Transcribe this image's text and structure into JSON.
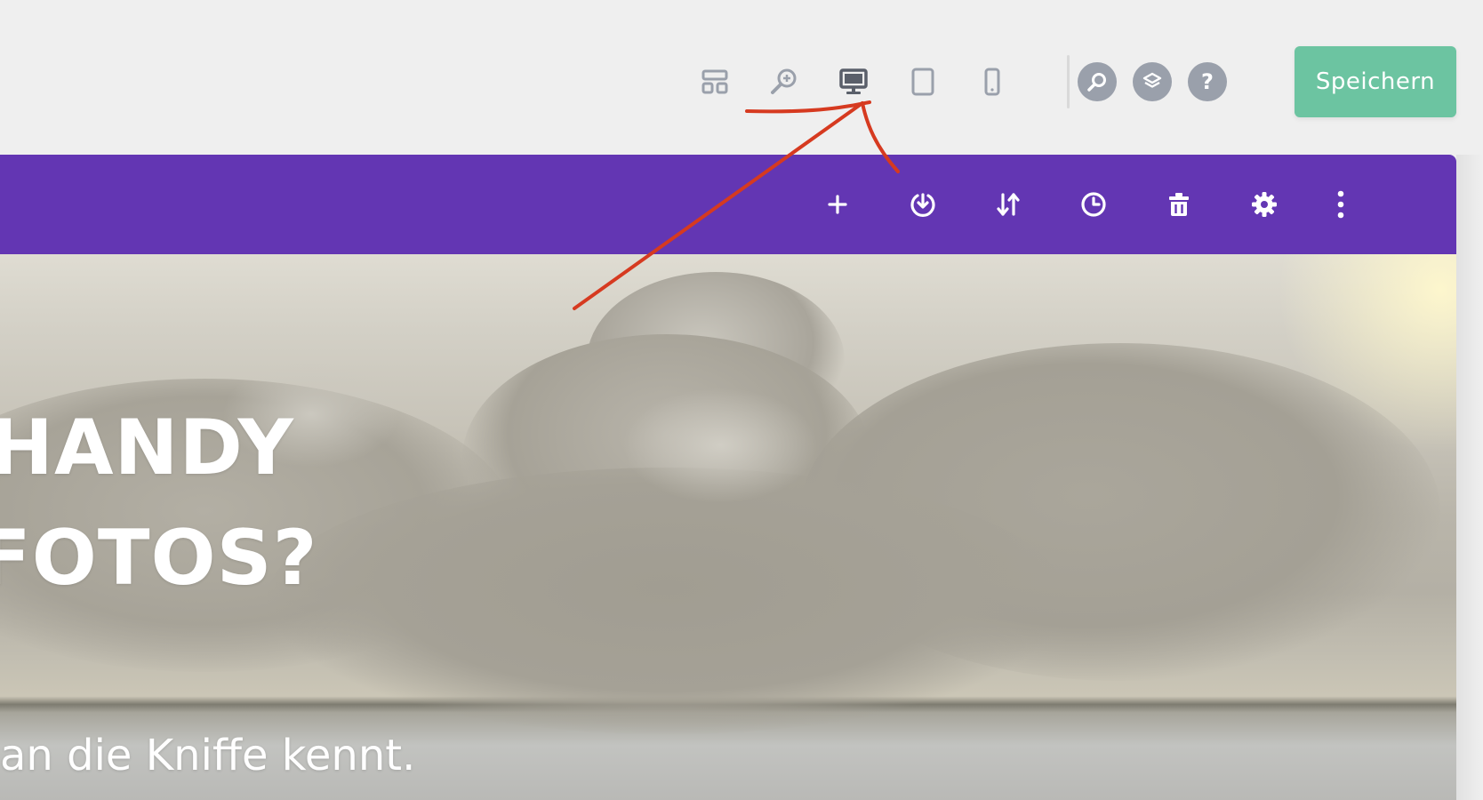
{
  "toolbar": {
    "icons": {
      "wireframe": "wireframe-layout-icon",
      "zoom": "zoom-icon",
      "desktop": "desktop-icon",
      "tablet": "tablet-icon",
      "phone": "phone-icon",
      "search": "search-icon",
      "layers": "layers-icon",
      "help": "help-icon"
    },
    "help_label": "?",
    "save_label": "Speichern",
    "save_color": "#6cc4a1",
    "active_icon_color": "#5a5f6a",
    "inactive_icon_color": "#9aa0ab"
  },
  "section_bar": {
    "color": "#6336b3",
    "icons": [
      "add-icon",
      "save-to-library-icon",
      "move-icon",
      "history-icon",
      "delete-icon",
      "settings-icon",
      "more-options-icon"
    ]
  },
  "hero": {
    "headline_line1": "HANDY",
    "headline_line2": "FOTOS?",
    "subline": "an die Kniffe kennt."
  },
  "annotation": {
    "color": "#d63a20"
  }
}
